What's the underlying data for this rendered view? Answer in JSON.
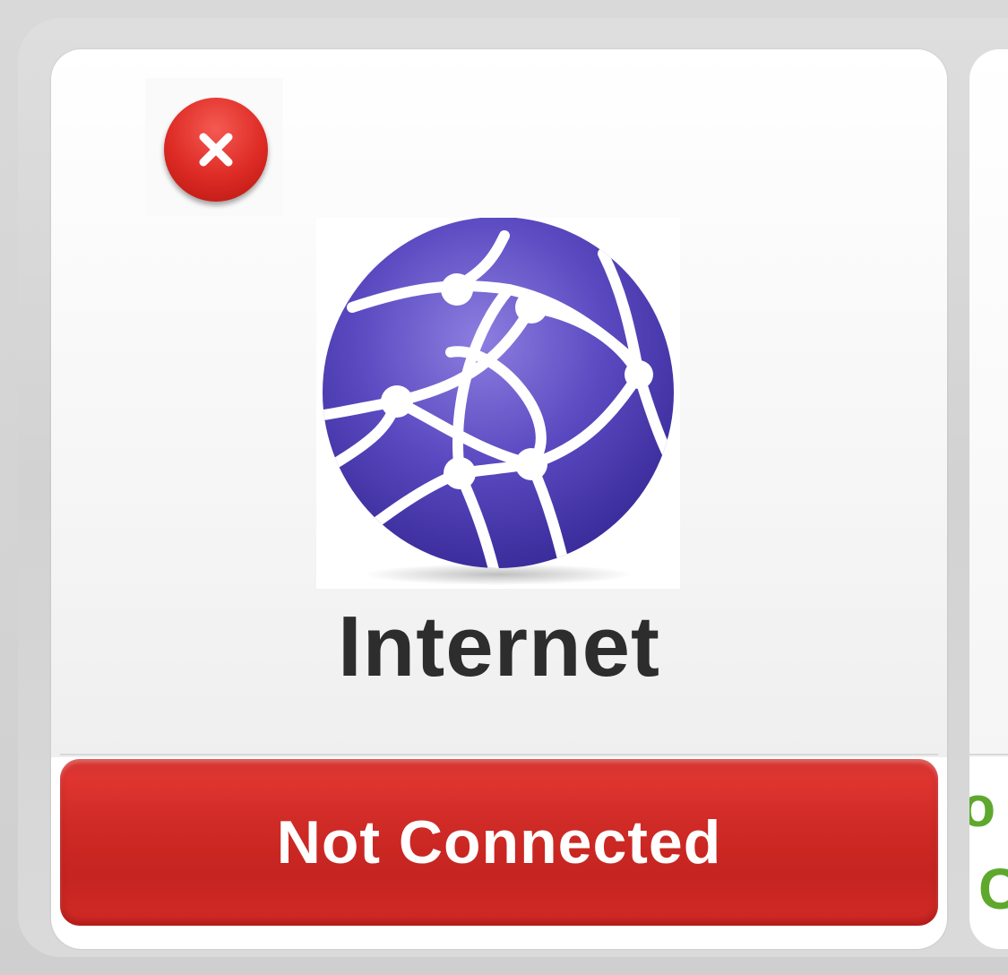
{
  "status_card": {
    "title": "Internet",
    "status": "Not Connected",
    "error_icon": "close-icon",
    "main_icon": "globe-network-icon",
    "colors": {
      "status_bar": "#d12b27",
      "error_badge": "#dd2a24",
      "globe": "#5a49c0",
      "title_text": "#2d2d2d"
    }
  },
  "next_card": {
    "status_line1": "o",
    "status_line2": "C",
    "status_color": "#5fa82e"
  }
}
